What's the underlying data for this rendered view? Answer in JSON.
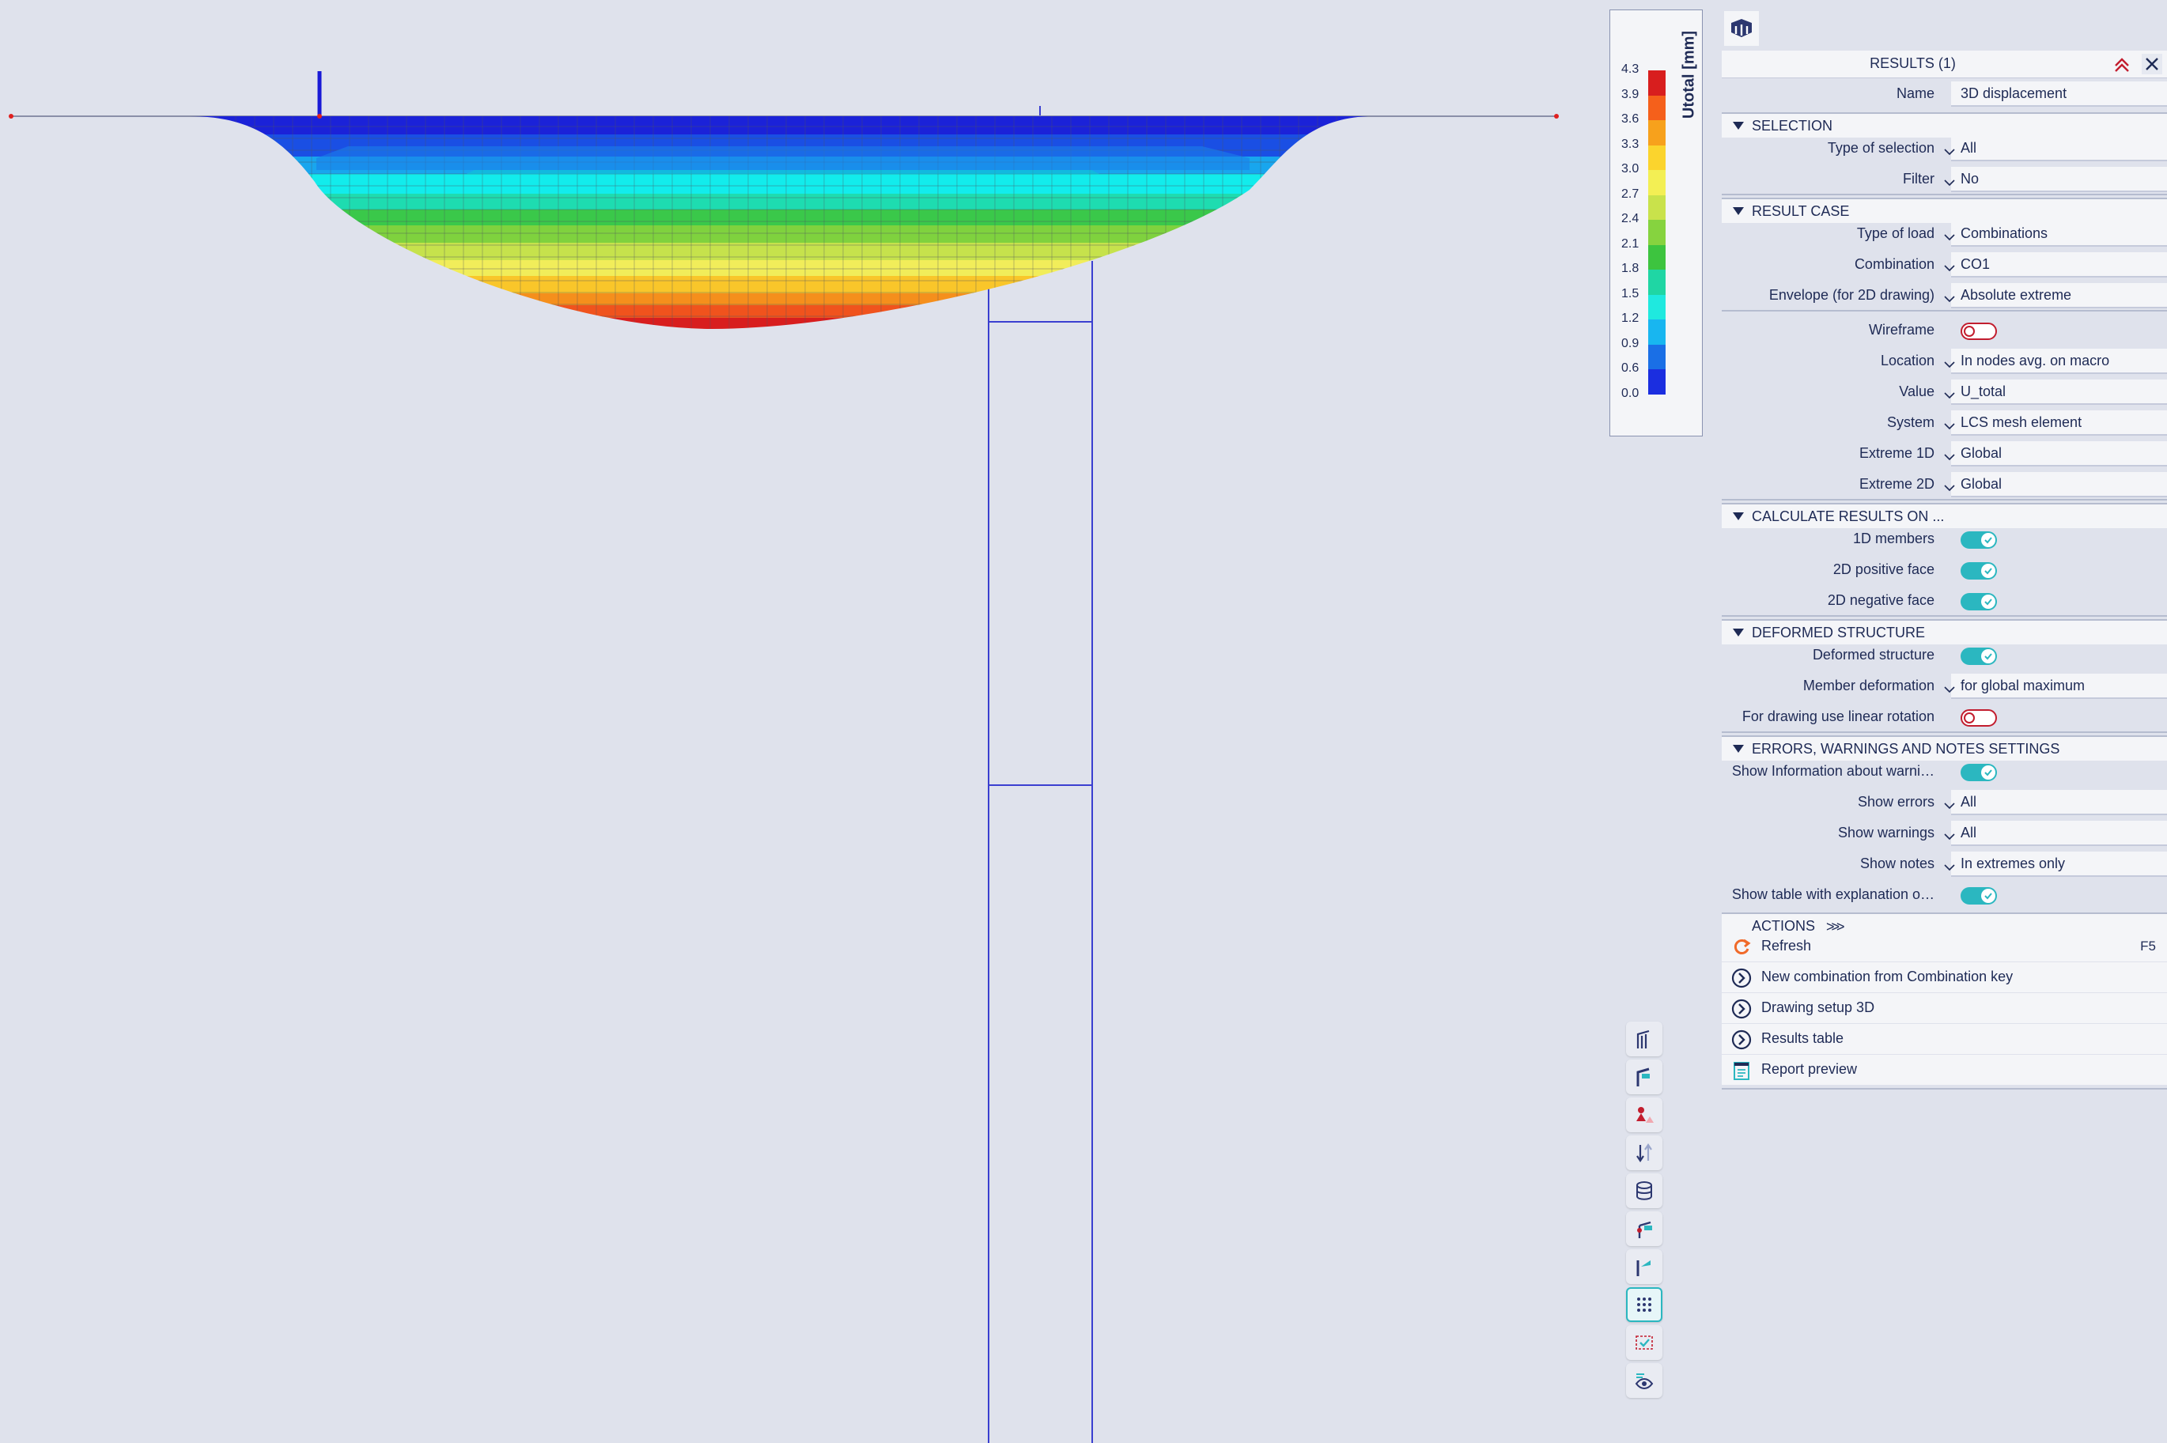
{
  "legend": {
    "unit_label": "Utotal [mm]",
    "values": [
      "4.3",
      "3.9",
      "3.6",
      "3.3",
      "3.0",
      "2.7",
      "2.4",
      "2.1",
      "1.8",
      "1.5",
      "1.2",
      "0.9",
      "0.6",
      "0.0"
    ],
    "colors": [
      "#d81e1e",
      "#f5601b",
      "#f7a11c",
      "#fbd42d",
      "#f3ef54",
      "#c9e24b",
      "#86d33f",
      "#3dc43f",
      "#1fd6a4",
      "#1fe9df",
      "#18b6f0",
      "#1a6fe6",
      "#1b2ee0"
    ]
  },
  "panel": {
    "title": "RESULTS (1)",
    "name_label": "Name",
    "name_value": "3D displacement",
    "sections": {
      "selection": "SELECTION",
      "result_case": "RESULT CASE",
      "calculate": "CALCULATE RESULTS ON ...",
      "deformed": "DEFORMED STRUCTURE",
      "errors": "ERRORS, WARNINGS AND NOTES SETTINGS"
    },
    "rows": {
      "type_of_selection": {
        "label": "Type of selection",
        "value": "All"
      },
      "filter": {
        "label": "Filter",
        "value": "No"
      },
      "type_of_load": {
        "label": "Type of load",
        "value": "Combinations"
      },
      "combination": {
        "label": "Combination",
        "value": "CO1"
      },
      "envelope": {
        "label": "Envelope (for 2D drawing)",
        "value": "Absolute extreme"
      },
      "wireframe": {
        "label": "Wireframe",
        "value": false
      },
      "location": {
        "label": "Location",
        "value": "In nodes avg. on macro"
      },
      "value": {
        "label": "Value",
        "value": "U_total"
      },
      "system": {
        "label": "System",
        "value": "LCS mesh element"
      },
      "extreme1d": {
        "label": "Extreme 1D",
        "value": "Global"
      },
      "extreme2d": {
        "label": "Extreme 2D",
        "value": "Global"
      },
      "members1d": {
        "label": "1D members",
        "value": true
      },
      "pos_face": {
        "label": "2D positive face",
        "value": true
      },
      "neg_face": {
        "label": "2D negative face",
        "value": true
      },
      "deformed_structure": {
        "label": "Deformed structure",
        "value": true
      },
      "member_deformation": {
        "label": "Member deformation",
        "value": "for global maximum"
      },
      "linear_rotation": {
        "label": "For drawing use linear rotation",
        "value": false
      },
      "show_info": {
        "label": "Show Information about warni…",
        "value": true
      },
      "show_errors": {
        "label": "Show errors",
        "value": "All"
      },
      "show_warnings": {
        "label": "Show warnings",
        "value": "All"
      },
      "show_notes": {
        "label": "Show notes",
        "value": "In extremes only"
      },
      "show_table": {
        "label": "Show table with explanation o…",
        "value": true
      }
    },
    "actions_label": "ACTIONS",
    "actions_more": ">>>",
    "actions": [
      {
        "label": "Refresh",
        "key": "F5",
        "icon": "refresh-icon"
      },
      {
        "label": "New combination from Combination key",
        "key": "",
        "icon": "circle-arrow-icon"
      },
      {
        "label": "Drawing setup 3D",
        "key": "",
        "icon": "circle-arrow-icon"
      },
      {
        "label": "Results table",
        "key": "",
        "icon": "circle-arrow-icon"
      },
      {
        "label": "Report preview",
        "key": "",
        "icon": "report-icon"
      }
    ]
  },
  "toolbar": {
    "buttons": [
      "structure-icon",
      "structure-color-icon",
      "load-icon",
      "load-arrows-icon",
      "library-icon",
      "check-icon",
      "member-results-icon",
      "mesh-grid-icon",
      "selection-icon",
      "view-icon"
    ]
  }
}
